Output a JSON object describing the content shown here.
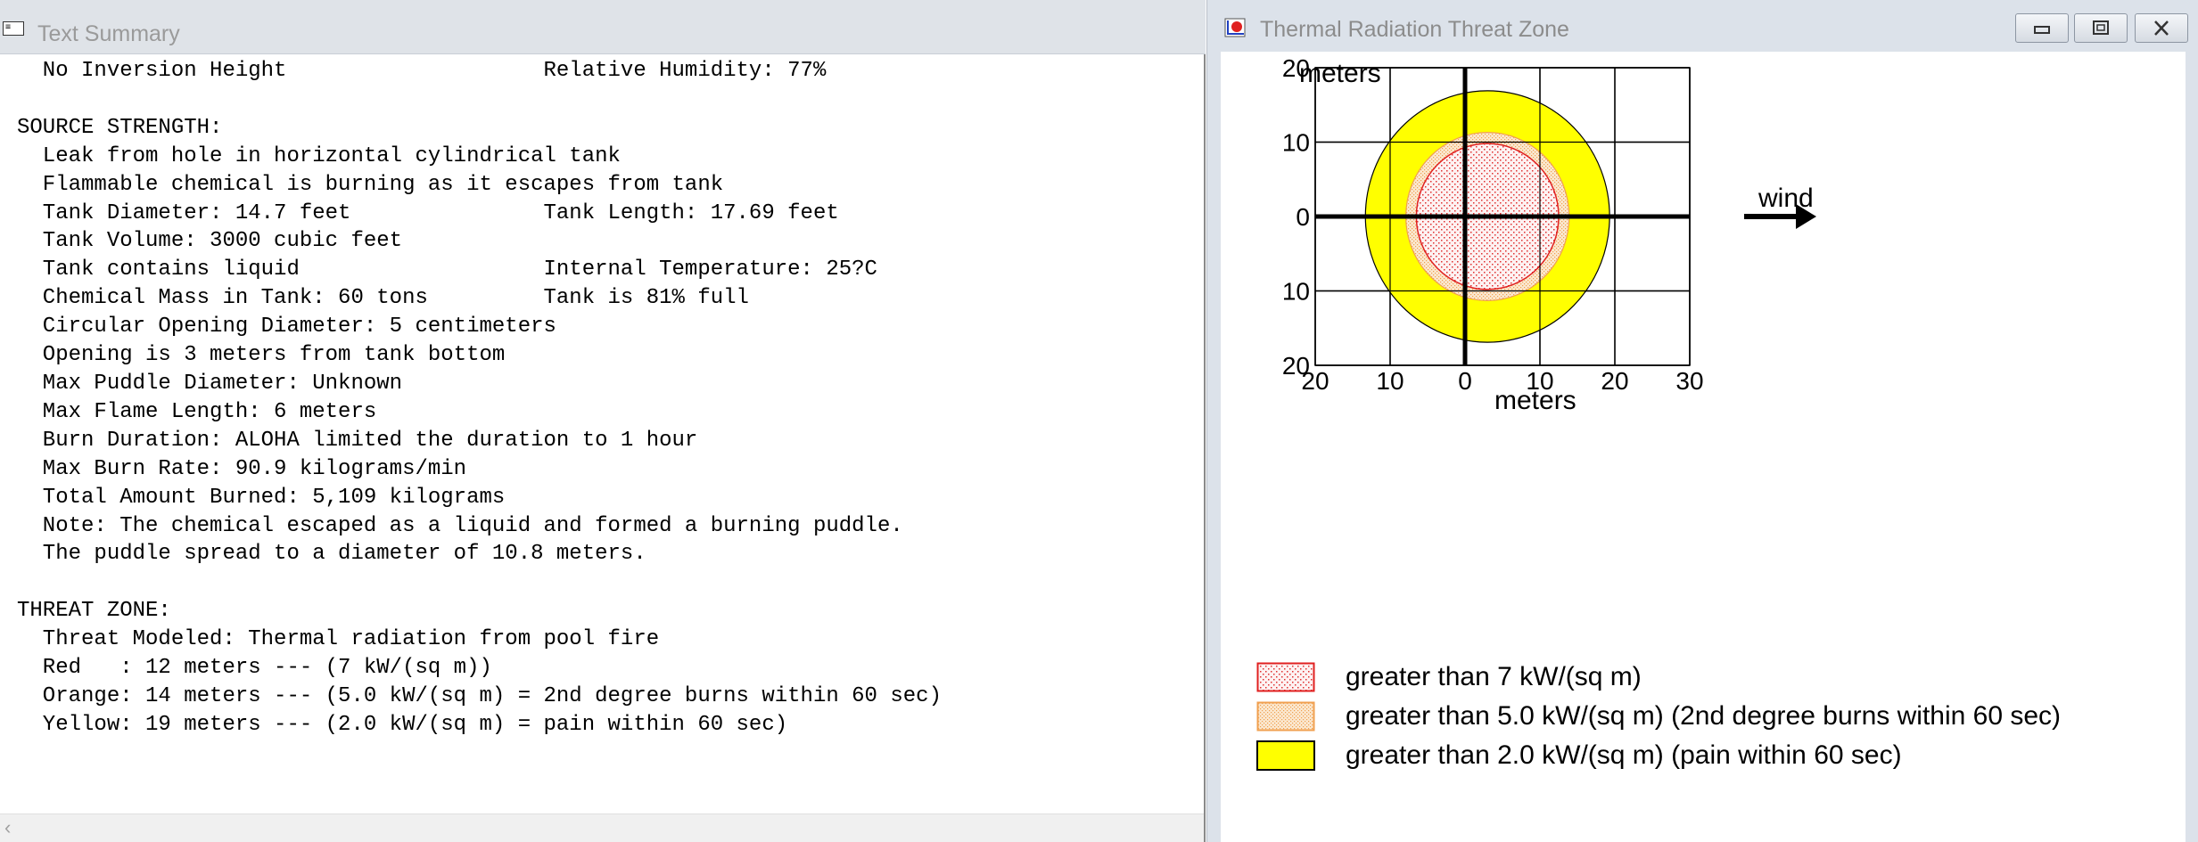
{
  "text_summary": {
    "title": "Text Summary",
    "icon": "document-icon",
    "lines": [
      "  No Inversion Height                    Relative Humidity: 77%",
      "",
      "SOURCE STRENGTH:",
      "  Leak from hole in horizontal cylindrical tank",
      "  Flammable chemical is burning as it escapes from tank",
      "  Tank Diameter: 14.7 feet               Tank Length: 17.69 feet",
      "  Tank Volume: 3000 cubic feet",
      "  Tank contains liquid                   Internal Temperature: 25?C",
      "  Chemical Mass in Tank: 60 tons         Tank is 81% full",
      "  Circular Opening Diameter: 5 centimeters",
      "  Opening is 3 meters from tank bottom",
      "  Max Puddle Diameter: Unknown",
      "  Max Flame Length: 6 meters",
      "  Burn Duration: ALOHA limited the duration to 1 hour",
      "  Max Burn Rate: 90.9 kilograms/min",
      "  Total Amount Burned: 5,109 kilograms",
      "  Note: The chemical escaped as a liquid and formed a burning puddle.",
      "  The puddle spread to a diameter of 10.8 meters.",
      "",
      "THREAT ZONE:",
      "  Threat Modeled: Thermal radiation from pool fire",
      "  Red   : 12 meters --- (7 kW/(sq m))",
      "  Orange: 14 meters --- (5.0 kW/(sq m) = 2nd degree burns within 60 sec)",
      "  Yellow: 19 meters --- (2.0 kW/(sq m) = pain within 60 sec)"
    ],
    "scroll_left_glyph": "‹"
  },
  "threat_window": {
    "title": "Thermal Radiation Threat Zone",
    "buttons": {
      "minimize": "▭",
      "maximize": "⧉",
      "close": "✕"
    }
  },
  "chart_data": {
    "type": "threat-zone-plot",
    "y_unit": "meters",
    "x_unit": "meters",
    "x_ticks": [
      {
        "value": -20,
        "label": "20"
      },
      {
        "value": -10,
        "label": "10"
      },
      {
        "value": 0,
        "label": "0"
      },
      {
        "value": 10,
        "label": "10"
      },
      {
        "value": 20,
        "label": "20"
      },
      {
        "value": 30,
        "label": "30"
      }
    ],
    "y_ticks": [
      {
        "value": 20,
        "label": "20"
      },
      {
        "value": 10,
        "label": "10"
      },
      {
        "value": 0,
        "label": "0"
      },
      {
        "value": -10,
        "label": "10"
      },
      {
        "value": -20,
        "label": "20"
      }
    ],
    "xlim": [
      -20,
      30
    ],
    "ylim": [
      -20,
      20
    ],
    "grid": true,
    "wind_label": "wind",
    "zones": [
      {
        "color": "yellow",
        "fill": "#ffff00",
        "center_x": 3,
        "center_y": 0,
        "radius_x": 16.3,
        "radius_y": 16.9
      },
      {
        "color": "orange",
        "fill": "#fbe1c2",
        "center_x": 3,
        "center_y": 0,
        "radius_x": 10.9,
        "radius_y": 11.3
      },
      {
        "color": "red",
        "fill": "#fbeaea",
        "center_x": 3,
        "center_y": 0,
        "radius_x": 9.5,
        "radius_y": 9.8
      }
    ],
    "legend": [
      {
        "label": "greater than 7 kW/(sq m)",
        "zone": "red"
      },
      {
        "label": "greater than 5.0 kW/(sq m) (2nd degree burns within 60 sec)",
        "zone": "orange"
      },
      {
        "label": "greater than 2.0 kW/(sq m) (pain within 60 sec)",
        "zone": "yellow"
      }
    ]
  }
}
